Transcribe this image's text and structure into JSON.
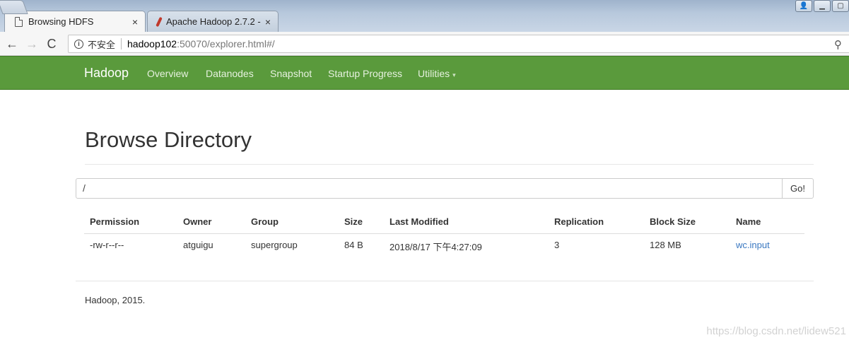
{
  "browser": {
    "tabs": [
      {
        "title": "Browsing HDFS",
        "close": "×"
      },
      {
        "title": "Apache Hadoop 2.7.2 -",
        "close": "×"
      }
    ],
    "window_buttons": [
      "👤",
      "▁",
      "▢"
    ],
    "nav": {
      "back": "←",
      "forward": "→",
      "reload": "C"
    },
    "security_label": "不安全",
    "url_host": "hadoop102",
    "url_rest": ":50070/explorer.html#/",
    "zoom": "⚲"
  },
  "navbar": {
    "brand": "Hadoop",
    "links": [
      "Overview",
      "Datanodes",
      "Snapshot",
      "Startup Progress",
      "Utilities"
    ],
    "utilities_caret": "▾"
  },
  "main": {
    "title": "Browse Directory",
    "path_value": "/",
    "go_label": "Go!",
    "table": {
      "headers": [
        "Permission",
        "Owner",
        "Group",
        "Size",
        "Last Modified",
        "Replication",
        "Block Size",
        "Name"
      ],
      "rows": [
        [
          "-rw-r--r--",
          "atguigu",
          "supergroup",
          "84 B",
          "2018/8/17 下午4:27:09",
          "3",
          "128 MB",
          "wc.input"
        ]
      ]
    },
    "footer": "Hadoop, 2015."
  },
  "watermark": "https://blog.csdn.net/lidew521",
  "colors": {
    "navbar": "#5a9a3c",
    "link": "#3a78c1"
  }
}
